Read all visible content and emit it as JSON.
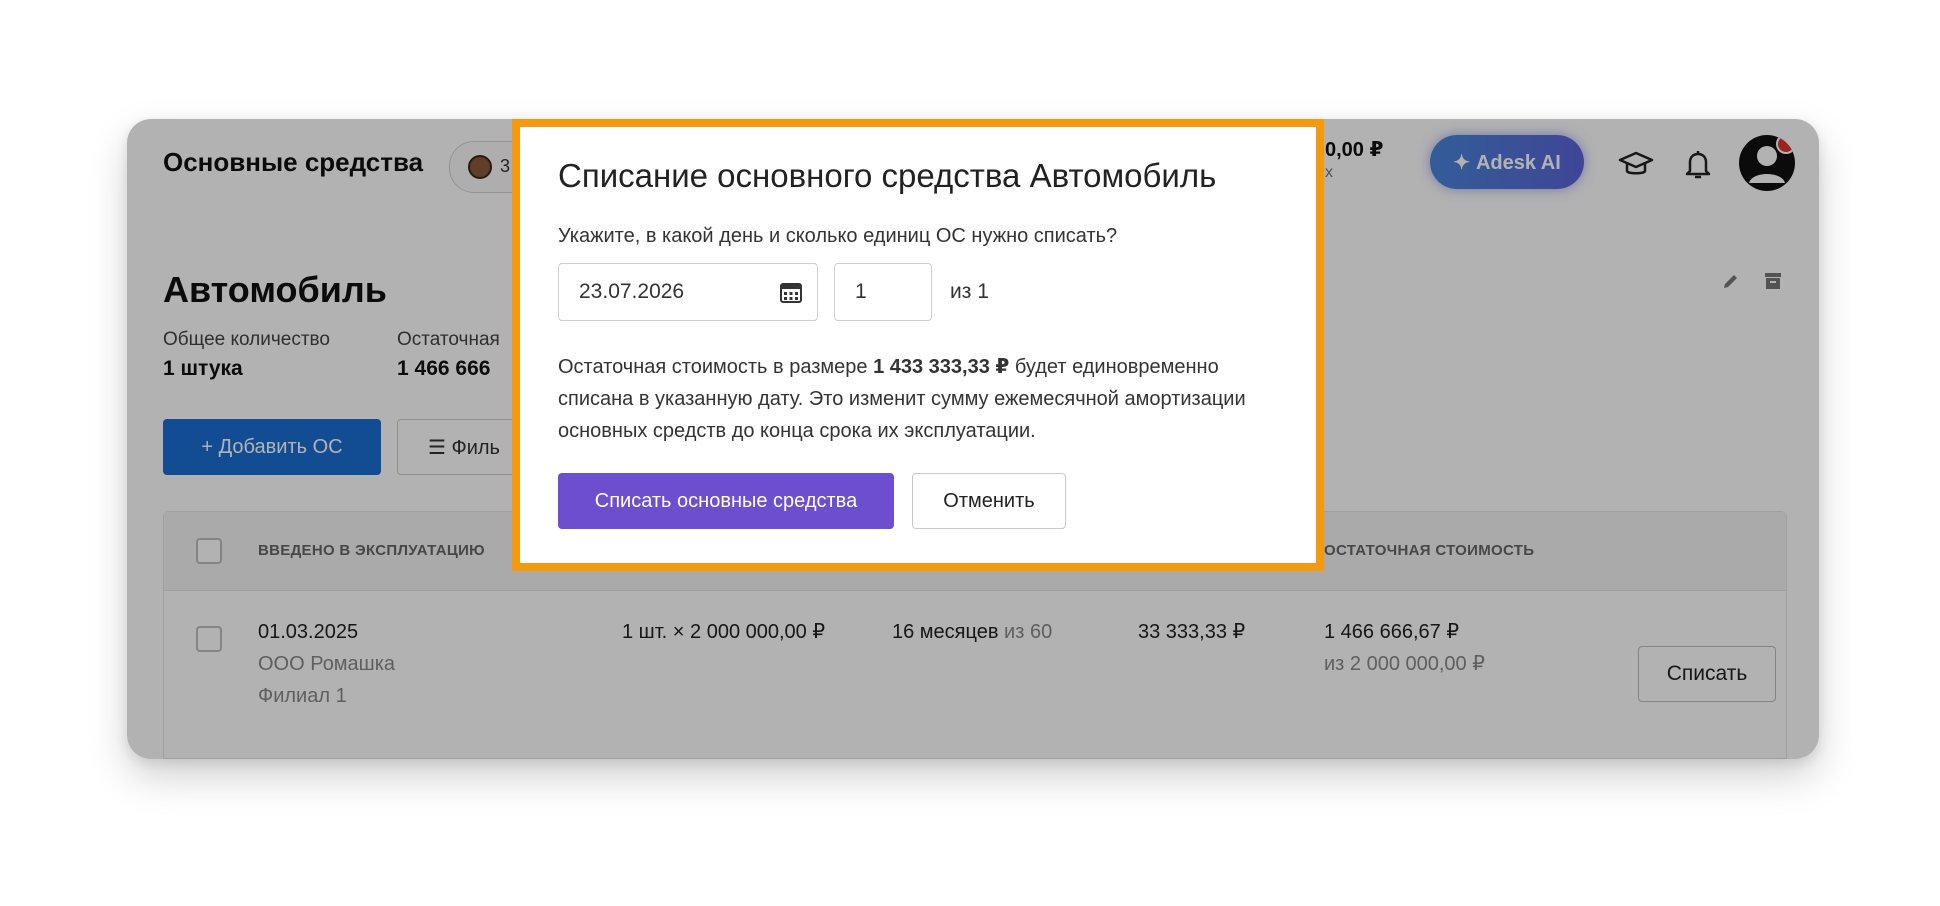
{
  "header": {
    "title": "Основные средства",
    "chip_text": "3",
    "balance_amount": "0,00 ₽",
    "balance_sub": "х",
    "ai_button": "Adesk AI"
  },
  "asset": {
    "name": "Автомобиль",
    "stats": [
      {
        "label": "Общее количество",
        "value": "1 штука"
      },
      {
        "label": "Остаточная",
        "value": "1 466 666"
      }
    ],
    "add_button": "Добавить ОС",
    "filter_button": "Филь"
  },
  "table": {
    "headers": {
      "date": "ВВЕДЕНО В ЭКСПЛУАТАЦИЮ",
      "residual": "ОСТАТОЧНАЯ СТОИМОСТЬ"
    },
    "row": {
      "date": "01.03.2025",
      "company": "ООО Ромашка",
      "branch": "Филиал 1",
      "quantity": "1 шт. × 2 000 000,00 ₽",
      "months": "16 месяцев",
      "months_total": "из 60",
      "monthly": "33 333,33 ₽",
      "residual": "1 466 666,67 ₽",
      "residual_total": "из 2 000 000,00 ₽",
      "writeoff_button": "Списать"
    }
  },
  "modal": {
    "title": "Списание основного средства Автомобиль",
    "question": "Укажите, в какой день и сколько единиц ОС нужно списать?",
    "date_value": "23.07.2026",
    "quantity_value": "1",
    "quantity_of": "из 1",
    "text_before": "Остаточная стоимость в размере ",
    "text_amount": "1 433 333,33 ₽",
    "text_after": " будет единовременно списана в указанную дату. Это изменит сумму ежемесячной амортизации основных средств до конца срока их эксплуатации.",
    "confirm_button": "Списать основные средства",
    "cancel_button": "Отменить"
  },
  "colors": {
    "primary_blue": "#1a6fd4",
    "purple": "#6b4fcf",
    "highlight_orange": "#f7990f"
  }
}
